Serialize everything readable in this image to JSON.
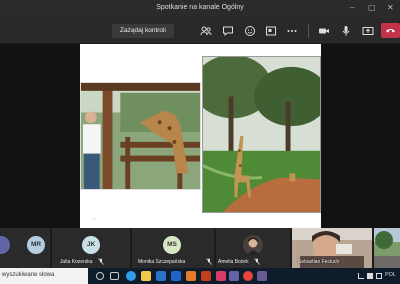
{
  "window": {
    "title": "Spotkanie na kanale Ogólny",
    "controls": {
      "minimize": "–",
      "maximize": "▢",
      "close": "✕"
    }
  },
  "toolbar": {
    "request_control_label": "Zażądaj kontroli",
    "icons": [
      "participants-icon",
      "chat-icon",
      "reactions-icon",
      "rooms-icon",
      "more-icon",
      "camera-icon",
      "mic-icon",
      "share-icon",
      "leave-icon"
    ]
  },
  "participants": [
    {
      "name": "",
      "initials": "",
      "color": "#6264a7",
      "muted": false
    },
    {
      "name": "",
      "initials": "MR",
      "color": "#b6cde0",
      "muted": false
    },
    {
      "name": "Julia Kozerska",
      "initials": "JK",
      "color": "#c9e0e6",
      "muted": true
    },
    {
      "name": "Monika Szczepańska",
      "initials": "MS",
      "color": "#d8e8c7",
      "muted": true
    },
    {
      "name": "Amelia Bożek",
      "initials": "",
      "color": "#555",
      "muted": true
    },
    {
      "name": "Sebastian Feciuch",
      "initials": "",
      "color": "#888",
      "muted": false
    }
  ],
  "taskbar": {
    "search_placeholder": "wyszukiwane słowa",
    "tray_language": "POL"
  },
  "colors": {
    "leave": "#c4314b",
    "accent": "#6264a7",
    "taskbar": "#0d1b2a"
  }
}
